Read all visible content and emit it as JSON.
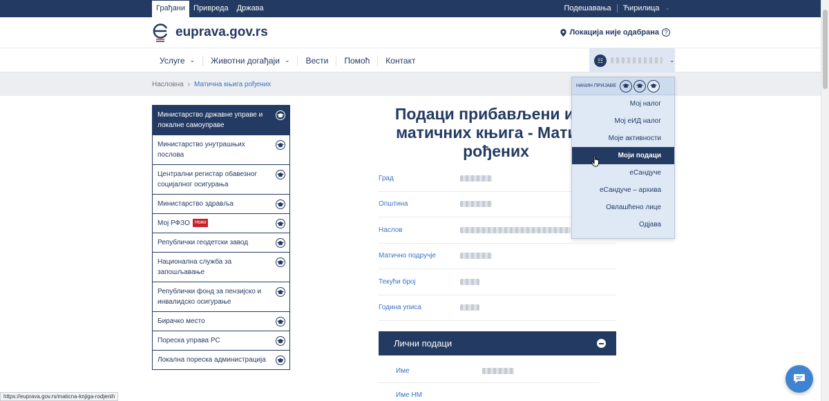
{
  "topbar": {
    "tabs": [
      {
        "label": "Грађани",
        "active": true
      },
      {
        "label": "Привреда",
        "active": false
      },
      {
        "label": "Држава",
        "active": false
      }
    ],
    "settings_label": "Подешавања",
    "script_label": "Ћирилица"
  },
  "header": {
    "logo_text": "euprava.gov.rs",
    "location_label": "Локација није одабрана",
    "help_glyph": "?"
  },
  "nav": {
    "items": [
      {
        "label": "Услуге",
        "has_dropdown": true
      },
      {
        "label": "Животни догађаји",
        "has_dropdown": true
      },
      {
        "label": "Вести",
        "has_dropdown": false
      },
      {
        "label": "Помоћ",
        "has_dropdown": false
      },
      {
        "label": "Контакт",
        "has_dropdown": false
      }
    ]
  },
  "breadcrumb": {
    "home": "Насловна",
    "separator": "›",
    "current": "Матична књига рођених"
  },
  "sidebar": {
    "items": [
      {
        "label": "Министарство државне управе и локалне самоуправе",
        "active": true
      },
      {
        "label": "Министарство унутрашњих послова"
      },
      {
        "label": "Централни регистар обавезног социјалног осигурања"
      },
      {
        "label": "Министарство здравља"
      },
      {
        "label": "Мој РФЗО",
        "badge": "Ново"
      },
      {
        "label": "Републички геодетски завод"
      },
      {
        "label": "Национална служба за запошљавање"
      },
      {
        "label": "Републички фонд за пензијско и инвалидско осигурање"
      },
      {
        "label": "Бирачко место"
      },
      {
        "label": "Пореска управа РС"
      },
      {
        "label": "Локална пореска администрација"
      }
    ]
  },
  "main": {
    "title_line1": "Подаци прибављени из Р",
    "title_line2": "матичних књига - Матичн",
    "title_line3": "рођених",
    "rows": [
      {
        "label": "Град"
      },
      {
        "label": "Општина"
      },
      {
        "label": "Наслов"
      },
      {
        "label": "Матично подручје"
      },
      {
        "label": "Текући број"
      },
      {
        "label": "Година уписа"
      }
    ],
    "section_title": "Лични подаци",
    "subrows": [
      {
        "label": "Име"
      },
      {
        "label": "Име НМ"
      }
    ]
  },
  "dropdown": {
    "login_label": "НАЧИН ПРИЈАВЕ",
    "items": [
      {
        "label": "Мој налог"
      },
      {
        "label": "Мој еИД налог"
      },
      {
        "label": "Моје активности"
      },
      {
        "label": "Моји подаци",
        "active": true
      },
      {
        "label": "еСандуче"
      },
      {
        "label": "еСандуче – архива"
      },
      {
        "label": "Овлашћено лице"
      },
      {
        "label": "Одјава"
      }
    ]
  },
  "status_url": "https://euprava.gov.rs/maticna-knjiga-rodjenih",
  "colors": {
    "primary": "#233a62",
    "link": "#3a72c4",
    "badge": "#c5222b",
    "chat": "#3f84d0"
  }
}
